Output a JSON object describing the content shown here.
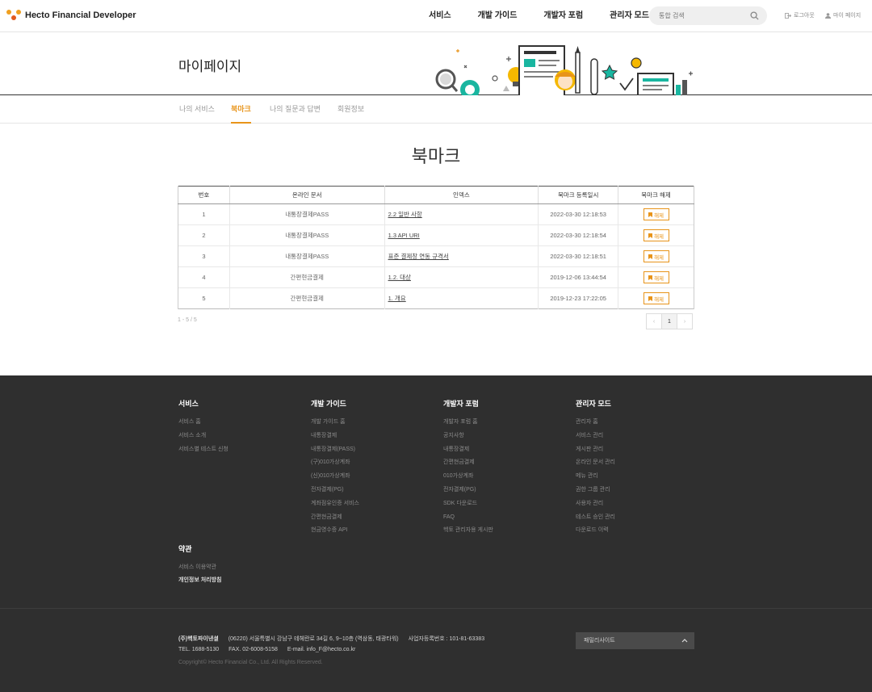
{
  "header": {
    "logo_text": "Hecto Financial Developer",
    "nav": [
      "서비스",
      "개발 가이드",
      "개발자 포럼",
      "관리자 모드"
    ],
    "search_placeholder": "통합 검색",
    "logout_label": "로그아웃",
    "mypage_label": "마이 페이지"
  },
  "banner": {
    "title": "마이페이지"
  },
  "tabs": [
    {
      "label": "나의 서비스",
      "active": false
    },
    {
      "label": "북마크",
      "active": true
    },
    {
      "label": "나의 질문과 답변",
      "active": false
    },
    {
      "label": "회원정보",
      "active": false
    }
  ],
  "section": {
    "title": "북마크"
  },
  "table": {
    "headers": [
      "번호",
      "온라인 문서",
      "인덱스",
      "북마크 등록일시",
      "북마크 해제"
    ],
    "remove_label": "해제",
    "rows": [
      {
        "no": "1",
        "doc": "내통장결제PASS",
        "index": "2.2 일반 사항",
        "date": "2022-03-30 12:18:53"
      },
      {
        "no": "2",
        "doc": "내통장결제PASS",
        "index": "1.3 API URI",
        "date": "2022-03-30 12:18:54"
      },
      {
        "no": "3",
        "doc": "내통장결제PASS",
        "index": "표준 결제창 연동 규격서",
        "date": "2022-03-30 12:18:51"
      },
      {
        "no": "4",
        "doc": "간편현금결제",
        "index": "1.2. 대상",
        "date": "2019-12-06 13:44:54"
      },
      {
        "no": "5",
        "doc": "간편현금결제",
        "index": "1. 개요",
        "date": "2019-12-23 17:22:05"
      }
    ]
  },
  "pagination": {
    "count": "1 - 5 / 5",
    "prev": "‹",
    "current": "1",
    "next": "›"
  },
  "footer": {
    "columns": [
      {
        "title": "서비스",
        "items": [
          "서비스 홈",
          "서비스 소개",
          "서비스별 테스트 신청"
        ]
      },
      {
        "title": "개발 가이드",
        "items": [
          "개발 가이드 홈",
          "내통장결제",
          "내통장결제(PASS)",
          "(구)010가상계좌",
          "(신)010가상계좌",
          "전자결제(PG)",
          "계좌점유인증 서비스",
          "간편현금결제",
          "현금영수증 API"
        ]
      },
      {
        "title": "개발자 포럼",
        "items": [
          "개발자 포럼 홈",
          "공지사항",
          "내통장결제",
          "간편현금결제",
          "010가상계좌",
          "전자결제(PG)",
          "SDK 다운로드",
          "FAQ",
          "헥토 관리자용 게시판"
        ]
      },
      {
        "title": "관리자 모드",
        "items": [
          "관리자 홈",
          "서비스 관리",
          "게시판 관리",
          "온라인 문서 관리",
          "메뉴 관리",
          "권한 그룹 관리",
          "사용자 관리",
          "테스트 승인 관리",
          "다운로드 이력"
        ]
      }
    ],
    "terms": {
      "title": "약관",
      "items": [
        "서비스 이용약관",
        "개인정보 처리방침"
      ]
    },
    "company": "(주)헥토파이낸셜",
    "address": "(06220) 서울특별시 강남구 테헤란로 34길 6, 9~10층 (역삼동, 태광타워)",
    "biz_no": "사업자등록번호 : 101-81-63383",
    "tel": "TEL. 1688-5130",
    "fax": "FAX. 02-6008-5158",
    "email": "E-mail. info_F@hecto.co.kr",
    "copyright": "Copyright© Hecto Financial Co., Ltd. All Rights Reserved.",
    "family_site": "패밀리사이트"
  },
  "colors": {
    "accent": "#e8941a",
    "footer_bg": "#2f2f2f"
  }
}
